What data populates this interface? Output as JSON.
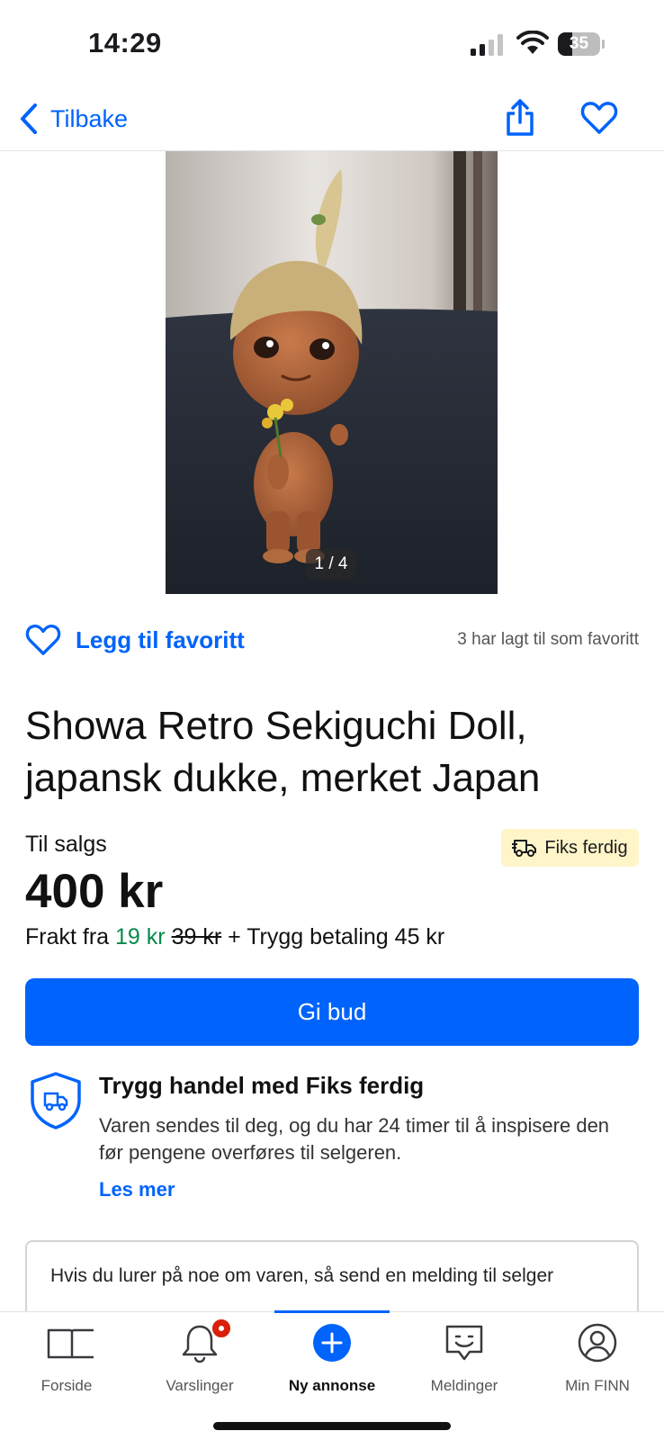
{
  "status_bar": {
    "time": "14:29",
    "battery_level": "35",
    "battery_fraction": 0.35
  },
  "nav": {
    "back_label": "Tilbake",
    "back_icon": "chevron-left-icon",
    "share_icon": "share-icon",
    "favorite_icon": "heart-icon"
  },
  "gallery": {
    "counter": "1 / 4"
  },
  "favorite": {
    "label": "Legg til favoritt",
    "count_text": "3 har lagt til som favoritt"
  },
  "listing": {
    "title": "Showa Retro Sekiguchi Doll, japansk dukke, merket Japan",
    "status": "Til salgs",
    "badge": "Fiks ferdig",
    "price": "400 kr",
    "shipping": {
      "prefix": "Frakt fra",
      "price": "19 kr",
      "old_price": "39 kr",
      "suffix": "+ Trygg betaling 45 kr"
    },
    "bid_button": "Gi bud"
  },
  "safe_trade": {
    "title": "Trygg handel med Fiks ferdig",
    "body": "Varen sendes til deg, og du har 24 timer til å inspisere den før pengene overføres til selgeren.",
    "link": "Les mer"
  },
  "message": {
    "text": "Hvis du lurer på noe om varen, så send en melding til selger"
  },
  "tabs": [
    {
      "label": "Forside",
      "icon": "book-icon"
    },
    {
      "label": "Varslinger",
      "icon": "bell-icon"
    },
    {
      "label": "Ny annonse",
      "icon": "plus-circle-icon"
    },
    {
      "label": "Meldinger",
      "icon": "chat-icon"
    },
    {
      "label": "Min FINN",
      "icon": "profile-icon"
    }
  ],
  "colors": {
    "accent": "#0063fb",
    "green": "#06894b",
    "badge_bg": "#fff5c8",
    "notification": "#d91f0a"
  }
}
